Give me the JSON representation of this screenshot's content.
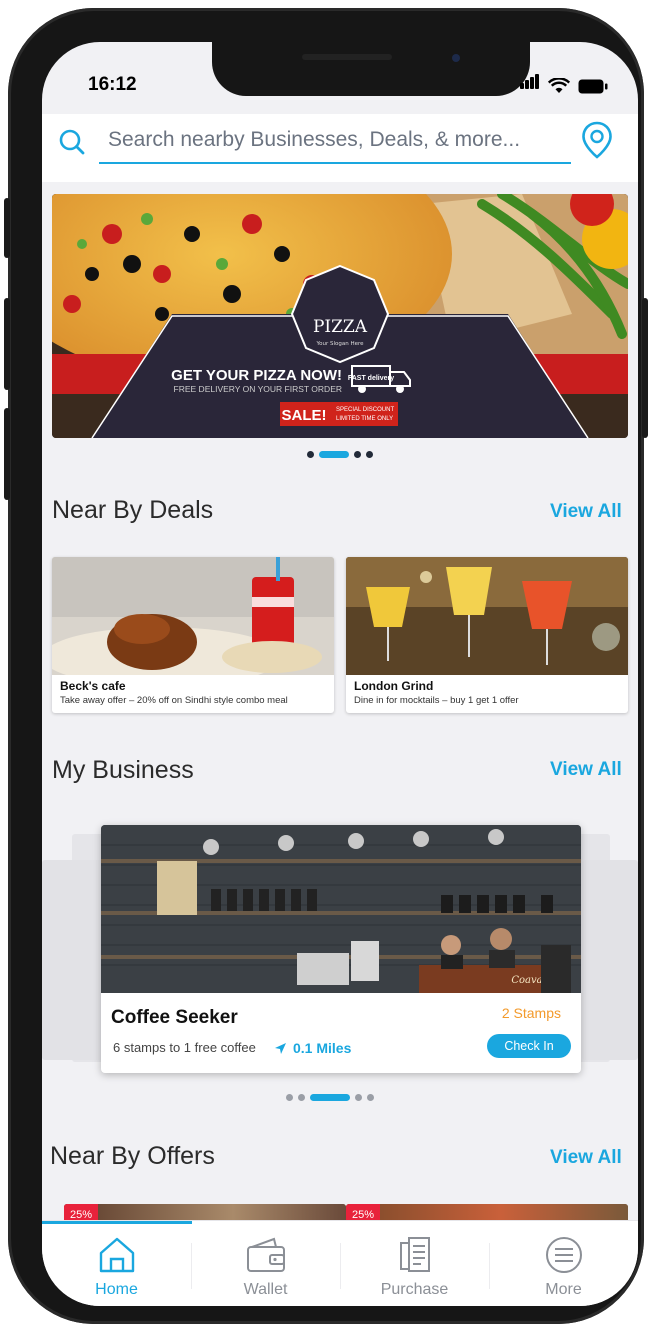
{
  "status": {
    "time": "16:12"
  },
  "search": {
    "placeholder": "Search  nearby  Businesses, Deals, & more..."
  },
  "banner": {
    "brand": "PIZZA",
    "slogan": "Your Slogan Here",
    "headline": "GET YOUR PIZZA NOW!",
    "subline": "FREE DELIVERY ON YOUR FIRST ORDER",
    "truck_text": "FAST delivery",
    "sale": "SALE!",
    "sale_note1": "SPECIAL DISCOUNT",
    "sale_note2": "LIMITED TIME ONLY"
  },
  "sections": {
    "deals": {
      "title": "Near By Deals",
      "view_all": "View All"
    },
    "business": {
      "title": "My Business",
      "view_all": "View All"
    },
    "offers": {
      "title": "Near By Offers",
      "view_all": "View All"
    }
  },
  "deals": [
    {
      "name": "Beck's cafe",
      "desc": "Take away offer – 20% off on Sindhi style combo meal"
    },
    {
      "name": "London Grind",
      "desc": "Dine in for mocktails – buy 1 get 1 offer"
    }
  ],
  "business_card": {
    "name": "Coffee Seeker",
    "stamps": "2 Stamps",
    "desc": "6 stamps to 1 free coffee",
    "miles": "0.1 Miles",
    "checkin": "Check In",
    "shop_sign": "Coava"
  },
  "offers": [
    {
      "badge": "25%"
    },
    {
      "badge": "25%"
    }
  ],
  "tabs": [
    {
      "label": "Home",
      "icon": "home-icon",
      "active": true
    },
    {
      "label": "Wallet",
      "icon": "wallet-icon",
      "active": false
    },
    {
      "label": "Purchase",
      "icon": "receipt-icon",
      "active": false
    },
    {
      "label": "More",
      "icon": "menu-icon",
      "active": false
    }
  ],
  "colors": {
    "accent": "#1aa7df",
    "stamps": "#f39a2b",
    "sale": "#e8223b"
  }
}
